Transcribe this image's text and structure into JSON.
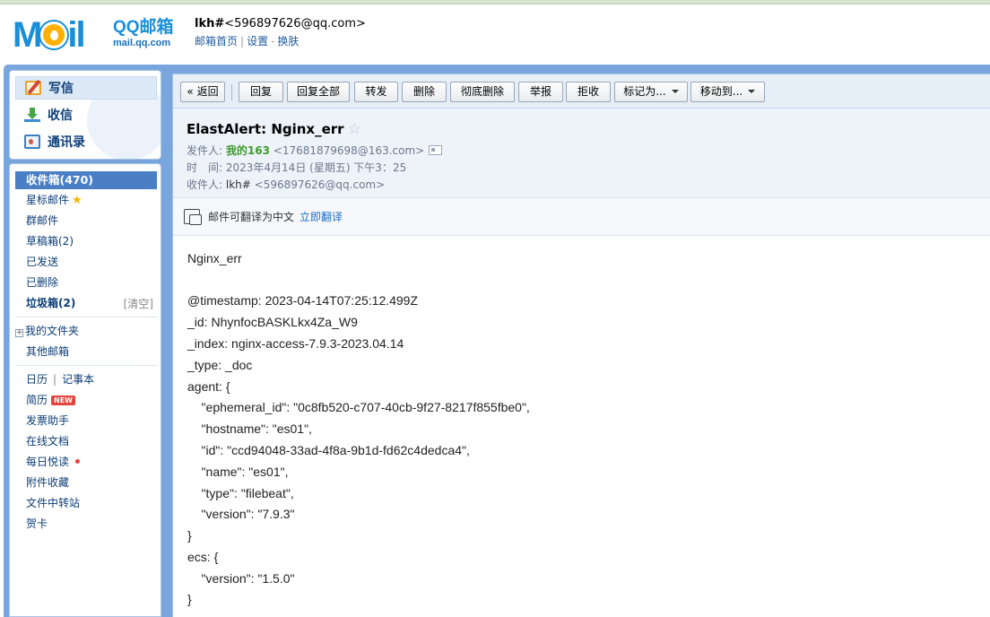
{
  "header": {
    "logo_main": "M",
    "logo_rest": "il",
    "logo_cn": "QQ邮箱",
    "logo_url": "mail.qq.com",
    "user_name": "lkh#",
    "user_email": "<596897626@qq.com>",
    "links": [
      "邮箱首页",
      "设置",
      "换肤"
    ]
  },
  "nav": {
    "write": "写信",
    "receive": "收信",
    "contacts": "通讯录"
  },
  "folders": {
    "inbox": "收件箱(470)",
    "starred": "星标邮件",
    "group": "群邮件",
    "drafts": "草稿箱(2)",
    "sent": "已发送",
    "deleted": "已删除",
    "spam": "垃圾箱(2)",
    "spam_clear": "[清空]",
    "my_folders": "我的文件夹",
    "other_mail": "其他邮箱",
    "calendar": "日历",
    "notebook": "记事本",
    "resume": "简历",
    "resume_badge": "NEW",
    "invoice": "发票助手",
    "docs": "在线文档",
    "daily": "每日悦读",
    "attachments": "附件收藏",
    "transfer": "文件中转站",
    "cards": "贺卡"
  },
  "toolbar": {
    "back": "« 返回",
    "reply": "回复",
    "reply_all": "回复全部",
    "forward": "转发",
    "delete": "删除",
    "delete_forever": "彻底删除",
    "report": "举报",
    "reject": "拒收",
    "mark_as": "标记为...",
    "move_to": "移动到..."
  },
  "mail": {
    "subject": "ElastAlert: Nginx_err",
    "star": "☆",
    "from_label": "发件人:",
    "from_name": "我的163",
    "from_email": "<17681879698@163.com>",
    "time_label": "时　间:",
    "time_value": "2023年4月14日 (星期五) 下午3：25",
    "to_label": "收件人:",
    "to_name": "lkh#",
    "to_email": "<596897626@qq.com>",
    "translate_text": "邮件可翻译为中文",
    "translate_link": "立即翻译",
    "body": [
      "Nginx_err",
      "",
      "@timestamp: 2023-04-14T07:25:12.499Z",
      "_id: NhynfocBASKLkx4Za_W9",
      "_index: nginx-access-7.9.3-2023.04.14",
      "_type: _doc",
      "agent: {",
      "    \"ephemeral_id\": \"0c8fb520-c707-40cb-9f27-8217f855fbe0\",",
      "    \"hostname\": \"es01\",",
      "    \"id\": \"ccd94048-33ad-4f8a-9b1d-fd62c4dedca4\",",
      "    \"name\": \"es01\",",
      "    \"type\": \"filebeat\",",
      "    \"version\": \"7.9.3\"",
      "}",
      "ecs: {",
      "    \"version\": \"1.5.0\"",
      "}"
    ]
  }
}
